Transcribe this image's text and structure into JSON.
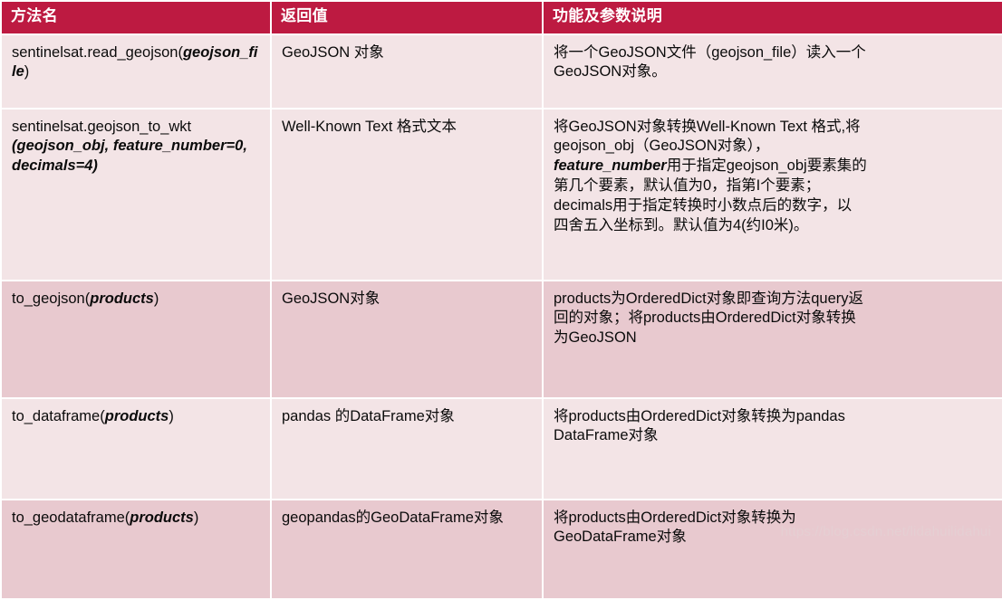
{
  "table": {
    "headers": [
      "方法名",
      "返回值",
      "功能及参数说明"
    ],
    "colors": {
      "header_bg": "#bd1a41",
      "header_text": "#ffffff",
      "row_light": "#f3e4e6",
      "row_dark": "#e8c9cf",
      "body_text": "#0b0b0b"
    },
    "rows": [
      {
        "shade": "light",
        "method_plain": "sentinelsat.read_geojson(",
        "method_arg": "geojson_file",
        "method_tail": ")",
        "method_full": "sentinelsat.read_geojson(geojson_file)",
        "returns": "GeoJSON 对象",
        "description": "将一个GeoJSON文件（geojson_file）读入一个GeoJSON对象。",
        "description_lines": [
          "将一个GeoJSON文件（geojson_file）读入一个",
          "GeoJSON对象。"
        ]
      },
      {
        "shade": "light",
        "method_plain": "sentinelsat.geojson_to_wkt",
        "method_arg": "(geojson_obj, feature_number=0, decimals=4)",
        "method_tail": "",
        "method_full": "sentinelsat.geojson_to_wkt(geojson_obj, feature_number=0, decimals=4)",
        "returns": "Well-Known Text 格式文本",
        "description": "将GeoJSON对象转换Well-Known Text 格式,将geojson_obj（GeoJSON对象），feature_number用于指定geojson_obj要素集的第几个要素，默认值为0，指第I个要素；decimals用于指定转换时小数点后的数字，以四舍五入坐标到。默认值为4(约I0米)。",
        "description_lines": [
          "将GeoJSON对象转换Well-Known Text 格式,将",
          "geojson_obj（GeoJSON对象），",
          "feature_number用于指定geojson_obj要素集的",
          "第几个要素，默认值为0，指第I个要素；",
          "decimals用于指定转换时小数点后的数字，以",
          "四舍五入坐标到。默认值为4(约I0米)。"
        ],
        "description_bold_token": "feature_number"
      },
      {
        "shade": "dark",
        "method_plain": "to_geojson(",
        "method_arg": "products",
        "method_tail": ")",
        "method_full": "to_geojson(products)",
        "returns": "GeoJSON对象",
        "description": "products为OrderedDict对象即查询方法query返回的对象；将products由OrderedDict对象转换为GeoJSON",
        "description_lines": [
          "products为OrderedDict对象即查询方法query返",
          "回的对象；将products由OrderedDict对象转换",
          "为GeoJSON"
        ]
      },
      {
        "shade": "light",
        "method_plain": "to_dataframe(",
        "method_arg": "products",
        "method_tail": ")",
        "method_full": "to_dataframe(products)",
        "returns": "pandas 的DataFrame对象",
        "description": "将products由OrderedDict对象转换为pandas DataFrame对象",
        "description_lines": [
          "将products由OrderedDict对象转换为pandas",
          "DataFrame对象"
        ]
      },
      {
        "shade": "dark",
        "method_plain": "to_geodataframe(",
        "method_arg": "products",
        "method_tail": ")",
        "method_full": "to_geodataframe(products)",
        "returns": "geopandas的GeoDataFrame对象",
        "description": "将products由OrderedDict对象转换为GeoDataFrame对象",
        "description_lines": [
          "将products由OrderedDict对象转换为",
          "GeoDataFrame对象"
        ]
      }
    ]
  },
  "watermark": "https://blog.csdn.net/lidahuilidahui"
}
